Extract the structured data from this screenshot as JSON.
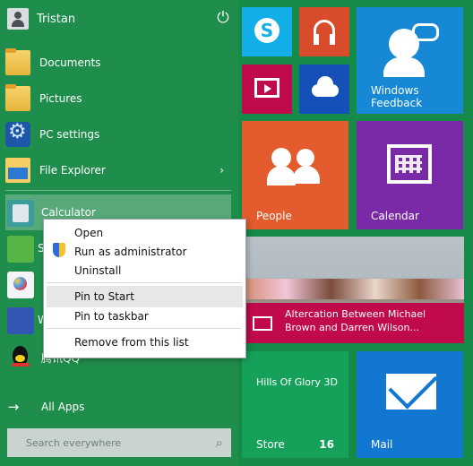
{
  "user": {
    "name": "Tristan"
  },
  "menu_items": [
    {
      "label": "Documents",
      "icon": "documents-icon"
    },
    {
      "label": "Pictures",
      "icon": "pictures-icon"
    },
    {
      "label": "PC settings",
      "icon": "settings-icon"
    },
    {
      "label": "File Explorer",
      "icon": "file-explorer-icon"
    }
  ],
  "apps": [
    {
      "label": "Calculator",
      "icon": "calculator-icon"
    },
    {
      "label": "S",
      "icon": "app-icon"
    },
    {
      "label": "",
      "icon": "paint-icon"
    },
    {
      "label": "W",
      "icon": "app-icon"
    },
    {
      "label": "腾讯QQ",
      "icon": "qq-icon"
    }
  ],
  "all_apps": "All Apps",
  "search": {
    "placeholder": "Search everywhere"
  },
  "context_menu": {
    "items": [
      "Open",
      "Run as administrator",
      "Uninstall",
      "Pin to Start",
      "Pin to taskbar",
      "Remove from this list"
    ]
  },
  "tiles": {
    "skype": {
      "icon": "skype-icon",
      "color": "#11aee8"
    },
    "music": {
      "icon": "headphones-icon",
      "color": "#d94c2b"
    },
    "feedback": {
      "label": "Windows Feedback",
      "line1": "Windows",
      "line2": "Feedback",
      "color": "#1788d5"
    },
    "video": {
      "icon": "video-icon",
      "color": "#c00a4b"
    },
    "onedrive": {
      "icon": "cloud-icon",
      "color": "#1450b8"
    },
    "people": {
      "label": "People",
      "color": "#e45b2d"
    },
    "calendar": {
      "label": "Calendar",
      "color": "#7a2aa6"
    },
    "news": {
      "headline": "Altercation Between Michael Brown and Darren Wilson...",
      "headline_line1": "Altercation Between Michael",
      "headline_line2": "Brown and Darren Wilson...",
      "color": "#c00a4b"
    },
    "store": {
      "label": "Store",
      "title": "Hills Of Glory 3D",
      "badge": "16",
      "color": "#16a15b"
    },
    "mail": {
      "label": "Mail",
      "color": "#1277d1"
    }
  }
}
